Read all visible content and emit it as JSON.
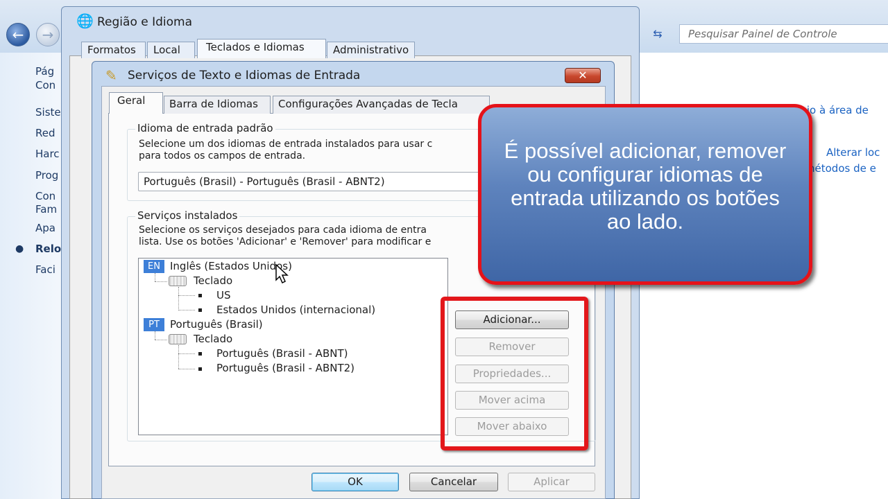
{
  "control_panel": {
    "back_icon": "back-arrow-icon",
    "search_placeholder": "Pesquisar Painel de Controle",
    "left_links": [
      "Pág",
      "Con",
      "Siste",
      "Red",
      "Harc",
      "Prog",
      "Con",
      "Fam",
      "Apa",
      "Relo",
      "Faci"
    ],
    "right_links": [
      "lógio à área de",
      "Alterar loc",
      "nétodos de e"
    ]
  },
  "outer_dialog": {
    "title": "Região e Idioma",
    "tabs": [
      "Formatos",
      "Local",
      "Teclados e Idiomas",
      "Administrativo"
    ],
    "active_tab": "Teclados e Idiomas"
  },
  "inner_dialog": {
    "title": "Serviços de Texto e Idiomas de Entrada",
    "close_label": "✕",
    "tabs": [
      "Geral",
      "Barra de Idiomas",
      "Configurações Avançadas de Tecla"
    ],
    "active_tab": "Geral",
    "default_group": {
      "label": "Idioma de entrada padrão",
      "desc_line1": "Selecione um dos idiomas de entrada instalados para usar c",
      "desc_line2": "para todos os campos de entrada.",
      "selected": "Português (Brasil) - Português (Brasil - ABNT2)"
    },
    "services_group": {
      "label": "Serviços instalados",
      "desc_line1": "Selecione os serviços desejados para cada idioma de entra",
      "desc_line2": "lista. Use os botões 'Adicionar' e 'Remover' para modificar e",
      "languages": [
        {
          "badge": "EN",
          "name": "Inglês (Estados Unidos)",
          "category": "Teclado",
          "layouts": [
            "US",
            "Estados Unidos (internacional)"
          ]
        },
        {
          "badge": "PT",
          "name": "Português (Brasil)",
          "category": "Teclado",
          "layouts": [
            "Português (Brasil - ABNT)",
            "Português (Brasil - ABNT2)"
          ]
        }
      ]
    },
    "side_buttons": {
      "add": "Adicionar...",
      "remove": "Remover",
      "properties": "Propriedades...",
      "move_up": "Mover acima",
      "move_down": "Mover abaixo"
    },
    "footer_buttons": {
      "ok": "OK",
      "cancel": "Cancelar",
      "apply": "Aplicar"
    }
  },
  "callout": {
    "text": "É possível adicionar, remover ou configurar idiomas de entrada utilizando os botões ao lado."
  },
  "colors": {
    "callout_border": "#e51219",
    "highlight_border": "#e3171b",
    "callout_fill": "#5e83bd",
    "lang_badge": "#3d7fd8"
  }
}
